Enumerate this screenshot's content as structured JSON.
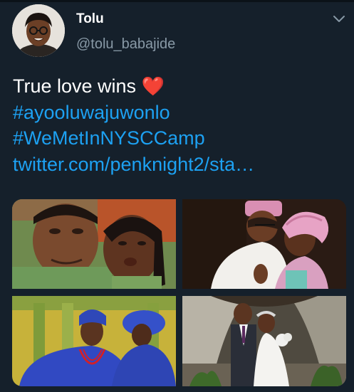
{
  "author": {
    "name": "Tolu",
    "handle": "@tolu_babajide"
  },
  "tweet": {
    "text": "True love wins",
    "emoji": "❤️",
    "hashtag_1": "#ayooluwajuwonlo",
    "hashtag_2": "#WeMetInNYSCCamp",
    "link": "twitter.com/penknight2/sta…"
  },
  "icons": {
    "menu": "chevron-down-icon",
    "heart": "red-heart-emoji"
  },
  "colors": {
    "background": "#15202b",
    "text": "#ffffff",
    "secondary_text": "#8899a6",
    "link": "#1da1f2",
    "heart": "#e0245e"
  },
  "media": {
    "count": 4
  }
}
